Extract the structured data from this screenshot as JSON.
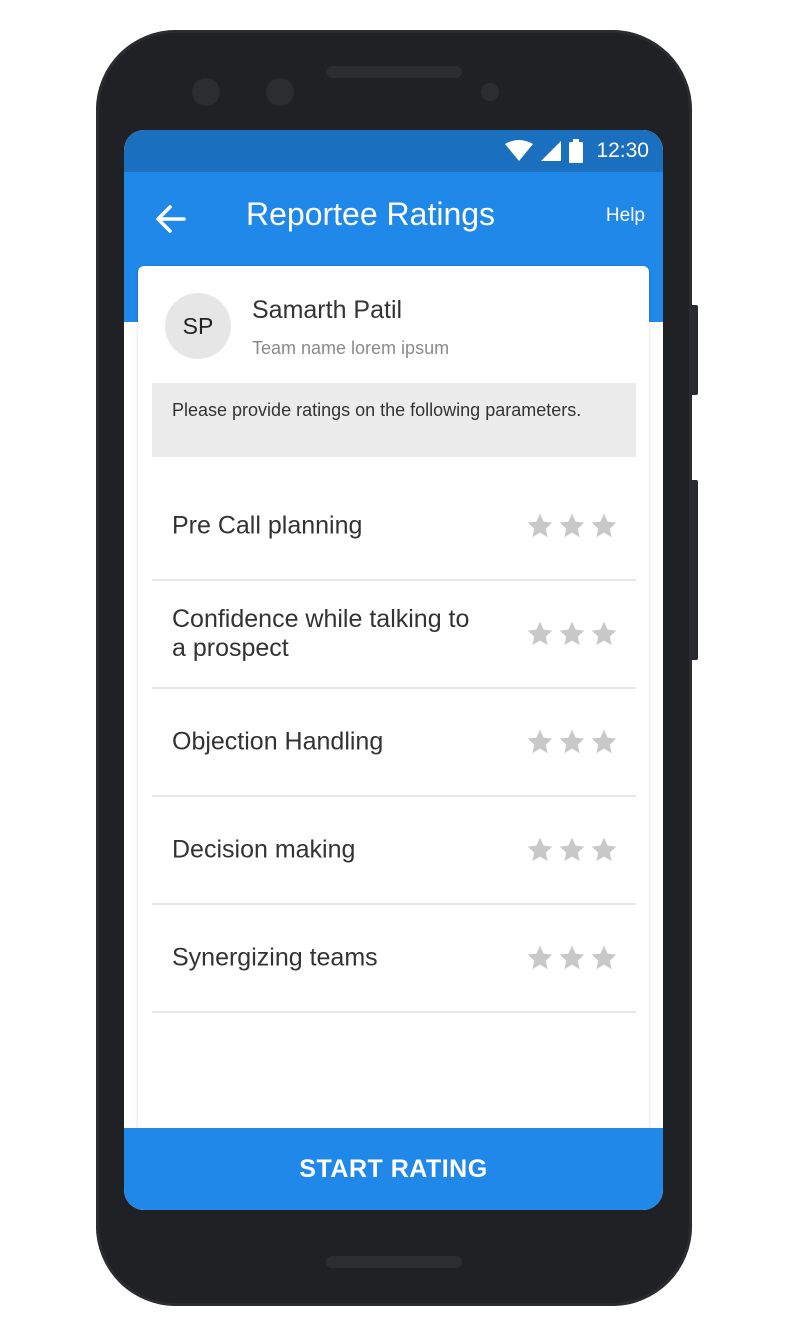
{
  "status_bar": {
    "time": "12:30"
  },
  "app_bar": {
    "title": "Reportee Ratings",
    "help_label": "Help",
    "back_icon": "arrow-left-icon"
  },
  "profile": {
    "initials": "SP",
    "name": "Samarth Patil",
    "team": "Team name lorem ipsum"
  },
  "instructions": "Please provide ratings on the following parameters.",
  "parameters": [
    {
      "label": "Pre Call planning",
      "rating": 0,
      "max": 3
    },
    {
      "label": "Confidence while talking to a prospect",
      "rating": 0,
      "max": 3
    },
    {
      "label": "Objection Handling",
      "rating": 0,
      "max": 3
    },
    {
      "label": "Decision making",
      "rating": 0,
      "max": 3
    },
    {
      "label": "Synergizing teams",
      "rating": 0,
      "max": 3
    }
  ],
  "start_button": {
    "label": "START RATING"
  },
  "colors": {
    "primary": "#2088e8",
    "status_bar": "#1a6fbf",
    "star_inactive": "#c8c8c8"
  }
}
